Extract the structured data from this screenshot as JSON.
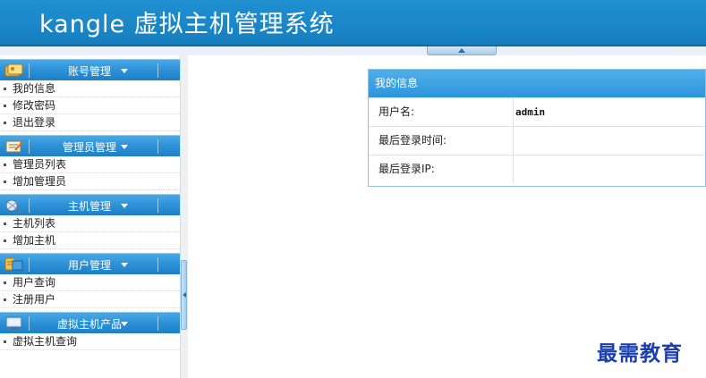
{
  "header": {
    "title": "kangle 虚拟主机管理系统"
  },
  "sidebar": {
    "sections": [
      {
        "title": "账号管理",
        "icon": "account-icon",
        "items": [
          "我的信息",
          "修改密码",
          "退出登录"
        ]
      },
      {
        "title": "管理员管理",
        "icon": "admin-icon",
        "items": [
          "管理员列表",
          "增加管理员"
        ]
      },
      {
        "title": "主机管理",
        "icon": "host-icon",
        "items": [
          "主机列表",
          "增加主机"
        ]
      },
      {
        "title": "用户管理",
        "icon": "user-icon",
        "items": [
          "用户查询",
          "注册用户"
        ]
      },
      {
        "title": "虚拟主机产品",
        "icon": "product-icon",
        "items": [
          "虚拟主机查询"
        ]
      }
    ]
  },
  "panel": {
    "title": "我的信息",
    "rows": [
      {
        "label": "用户名:",
        "value": "admin"
      },
      {
        "label": "最后登录时间:",
        "value": ""
      },
      {
        "label": "最后登录IP:",
        "value": ""
      }
    ]
  },
  "watermark": "最需教育",
  "colors": {
    "header": "#1a86c8",
    "section_head": "#2a8fd6",
    "panel_head": "#3da2e2",
    "watermark": "#1b3fb0"
  }
}
